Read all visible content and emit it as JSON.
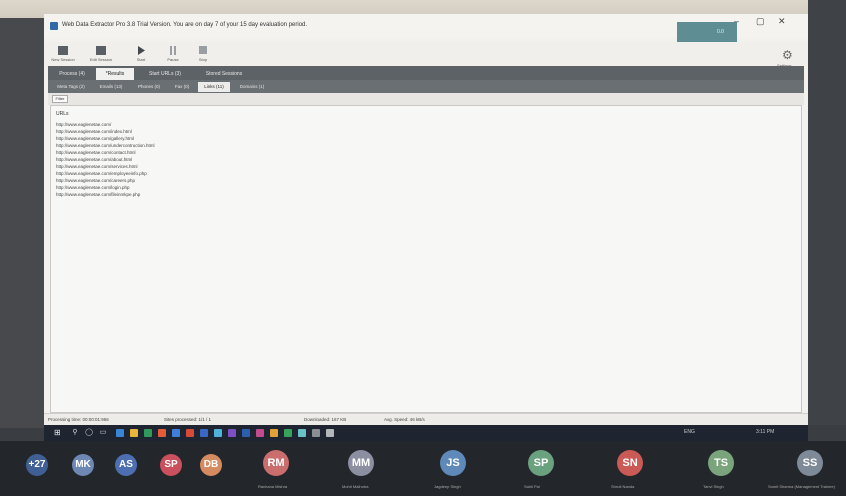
{
  "window": {
    "title": "Web Data Extractor Pro 3.8 Trial Version. You are on day 7 of your 15 day evaluation period.",
    "teal_text": "0.0",
    "controls": {
      "minimize": "–",
      "maximize": "▢",
      "close": "✕"
    }
  },
  "toolbar": {
    "buttons": [
      {
        "label": "New Session"
      },
      {
        "label": "Edit Session"
      },
      {
        "label": "Start"
      },
      {
        "label": "Pause"
      },
      {
        "label": "Stop"
      }
    ],
    "settings_label": "Settings"
  },
  "main_tabs": [
    "Process (4)",
    "*Results",
    "Start URLs (3)",
    "Stored Sessions"
  ],
  "sub_tabs": [
    "Meta Tags (2)",
    "Emails (13)",
    "Phones (0)",
    "Fax (0)",
    "Links (11)",
    "Domains (1)"
  ],
  "filter_label": "Filter",
  "results": {
    "column": "URLs",
    "urls": [
      "http://www.eaglenetae.com/",
      "http://www.eaglenetae.com/index.html",
      "http://www.eaglenetae.com/gallery.html",
      "http://www.eaglenetae.com/undercontruction.html",
      "http://www.eaglenetae.com/contact.html",
      "http://www.eaglenetae.com/about.html",
      "http://www.eaglenetae.com/services.html",
      "http://www.eaglenetae.com/employeeinfo.php",
      "http://www.eaglenetae.com/careers.php",
      "http://www.eaglenetae.com/login.php",
      "http://www.eaglenetae.com/fileinmkpe.php"
    ]
  },
  "status": {
    "processing": "Processing time: 00:00:01:956",
    "processed": "Sites processed: 1/1 / 1",
    "downloaded": "Downloaded: 167 KB",
    "speed": "Avg. Speed: 46 kB/s"
  },
  "taskbar": {
    "start_icon": "windows-icon",
    "tray_text": "ENG",
    "clock": "3:11 PM"
  },
  "participants": [
    {
      "initials": "+27",
      "color": "#3f5f95",
      "caption": ""
    },
    {
      "initials": "MK",
      "color": "#6f87b3",
      "caption": ""
    },
    {
      "initials": "AS",
      "color": "#4d6fb1",
      "caption": ""
    },
    {
      "initials": "SP",
      "color": "#c9505c",
      "caption": ""
    },
    {
      "initials": "DB",
      "color": "#d58a5f",
      "caption": ""
    },
    {
      "initials": "RM",
      "color": "#c96d6d",
      "caption": "Rachana Mishra"
    },
    {
      "initials": "MM",
      "color": "#8c8fa2",
      "caption": "Mohit Malhotra"
    },
    {
      "initials": "JS",
      "color": "#5e89b8",
      "caption": "Jagdeep Singh"
    },
    {
      "initials": "SP",
      "color": "#6aa17e",
      "caption": "Sahil Pal"
    },
    {
      "initials": "SN",
      "color": "#c95a56",
      "caption": "Shruti Nanda"
    },
    {
      "initials": "TS",
      "color": "#7aa47c",
      "caption": "Tanvi Singh"
    },
    {
      "initials": "SS",
      "color": "#7f8a98",
      "caption": "Sumit Sharma (Management Trainee)"
    }
  ],
  "colors": {
    "tab_bar": "#5d6266",
    "accent_teal": "#5e8e93",
    "taskbar": "#1e2430"
  }
}
